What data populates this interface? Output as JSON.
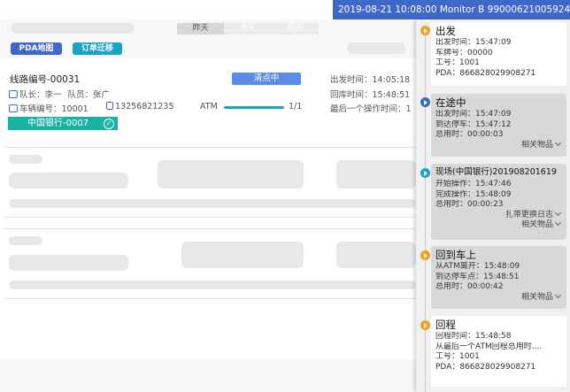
{
  "header": {
    "system_info": "2019-08-21 10:08:00 Monitor B  99000621005924..."
  },
  "day_tabs": [
    {
      "label": "昨天",
      "active": true
    },
    {
      "label": "今天",
      "active": false
    },
    {
      "label": "明天",
      "active": false
    }
  ],
  "toolbar": {
    "pda_map_label": "PDA地图",
    "order_migrate_label": "订单迁移"
  },
  "route_card": {
    "route_no": "线路编号-00031",
    "status": "清点中",
    "leader": "队长：李一",
    "member": "队员：张广",
    "vehicle": "车辆编号：10001",
    "phone": "13256821235",
    "atm_label": "ATM",
    "atm_progress": 1.0,
    "atm_count": "1/1",
    "bank_tag": "中国银行-0007",
    "depart_time": "出发时间：14:05:18",
    "return_time": "回库时间：15:48:51",
    "last_op_time": "最后一个操作时间：1"
  },
  "timeline": {
    "items": [
      {
        "title": "出发",
        "dot": "orange",
        "lines": [
          "出发时间：15:47:09",
          "车牌号：00000",
          "工号：1001",
          "PDA：866828029908271"
        ],
        "links": []
      },
      {
        "title": "在途中",
        "dot": "blue",
        "lines": [
          "出发时间：15:47:09",
          "到达停车：15:47:12",
          "总用时：00:00:03"
        ],
        "links": [
          "相关物品"
        ]
      },
      {
        "title": "现场(中国银行)201908201619",
        "dot": "teal",
        "lines": [
          "开始操作：15:47:46",
          "完成操作：15:48:09",
          "总用时：00:00:23"
        ],
        "links": [
          "扎带更换日志",
          "相关物品"
        ]
      },
      {
        "title": "回到车上",
        "dot": "orange",
        "lines": [
          "从ATM离开：15:48:09",
          "到达停车点：15:48:51",
          "总用时：00:00:42"
        ],
        "links": [
          "相关物品"
        ]
      },
      {
        "title": "回程",
        "dot": "orange",
        "lines": [
          "回程时间：15:48:58",
          "从最后一个ATM回程总用时....",
          "工号：1001",
          "PDA：866828029908271"
        ],
        "links": []
      }
    ]
  }
}
